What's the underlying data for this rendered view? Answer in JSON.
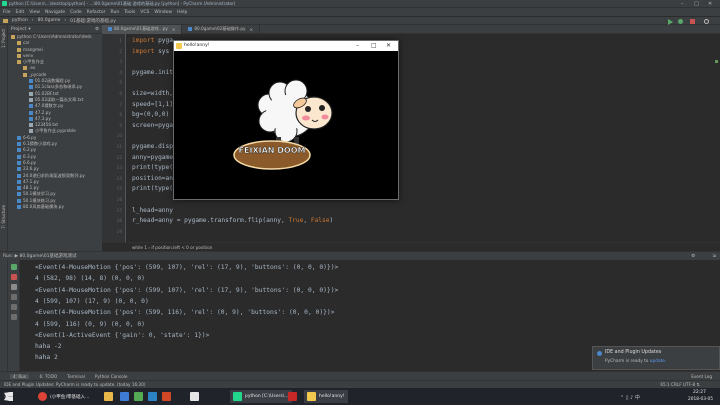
{
  "window": {
    "title": "python [C:\\Users\\...\\desktop\\python] - ...\\80.0game\\01基础:游戏的基础.py [python] - PyCharm (Administrator)"
  },
  "menu": [
    "File",
    "Edit",
    "View",
    "Navigate",
    "Code",
    "Refactor",
    "Run",
    "Tools",
    "VCS",
    "Window",
    "Help"
  ],
  "nav": {
    "crumbs": [
      "python",
      "80.0game",
      "01基础:游戏的基础.py"
    ]
  },
  "project": {
    "header": "Project",
    "items": [
      {
        "label": "python  C:\\Users\\Administrator\\desk",
        "kind": "folder",
        "indent": 0
      },
      {
        "label": "car",
        "kind": "folder",
        "indent": 1
      },
      {
        "label": "mangmei",
        "kind": "folder",
        "indent": 1
      },
      {
        "label": "venv",
        "kind": "folder",
        "indent": 1
      },
      {
        "label": "小甲鱼作业",
        "kind": "folder",
        "indent": 1
      },
      {
        "label": ".ex",
        "kind": "folder",
        "indent": 2
      },
      {
        "label": "_pycode",
        "kind": "folder",
        "indent": 2
      },
      {
        "label": "01.02函数编程.py",
        "kind": "py",
        "indent": 3
      },
      {
        "label": "01.1class多态和继承.py",
        "kind": "py",
        "indent": 3
      },
      {
        "label": "01.02BF.txt",
        "kind": "txt",
        "indent": 3
      },
      {
        "label": "05.02读取一篇长文章.txt",
        "kind": "txt",
        "indent": 3
      },
      {
        "label": "47.0猜数字.py",
        "kind": "py",
        "indent": 3
      },
      {
        "label": "47.2.py",
        "kind": "py",
        "indent": 3
      },
      {
        "label": "47.3.py",
        "kind": "py",
        "indent": 3
      },
      {
        "label": "123456.txt",
        "kind": "txt",
        "indent": 3
      },
      {
        "label": "小甲鱼作业.pyproble",
        "kind": "txt",
        "indent": 3
      },
      {
        "label": "6-6.py",
        "kind": "py",
        "indent": 1
      },
      {
        "label": "6.1猜数小游戏.py",
        "kind": "py",
        "indent": 1
      },
      {
        "label": "6.2.py",
        "kind": "py",
        "indent": 1
      },
      {
        "label": "6.3.py",
        "kind": "py",
        "indent": 1
      },
      {
        "label": "6.6.py",
        "kind": "py",
        "indent": 1
      },
      {
        "label": "23.6.py",
        "kind": "py",
        "indent": 1
      },
      {
        "label": "24.0递归求阶乘斐波那契数列.py",
        "kind": "py",
        "indent": 1
      },
      {
        "label": "47.1.py",
        "kind": "py",
        "indent": 1
      },
      {
        "label": "48.1.py",
        "kind": "py",
        "indent": 1
      },
      {
        "label": "50.1模块学习.py",
        "kind": "py",
        "indent": 1
      },
      {
        "label": "50.1模块练习.py",
        "kind": "py",
        "indent": 1
      },
      {
        "label": "80.0风扇基础模块.py",
        "kind": "py",
        "indent": 1
      }
    ]
  },
  "editor": {
    "tabs": [
      "80.0game\\01基础游戏...py",
      "80.0game\\02基础操作.py"
    ],
    "lines": [
      {
        "n": "1",
        "text": "import pyga"
      },
      {
        "n": "2",
        "text": "import sys"
      },
      {
        "n": "3",
        "text": ""
      },
      {
        "n": "4",
        "text": "pygame.init"
      },
      {
        "n": "5",
        "text": ""
      },
      {
        "n": "6",
        "text": "size=width,"
      },
      {
        "n": "7",
        "text": "speed=[1,1]"
      },
      {
        "n": "8",
        "text": "bg=(0,0,0)"
      },
      {
        "n": "9",
        "text": "screen=pyga"
      },
      {
        "n": "10",
        "text": ""
      },
      {
        "n": "11",
        "text": "pygame.disp"
      },
      {
        "n": "12",
        "text": "anny=pygame"
      },
      {
        "n": "13",
        "text": "print(type("
      },
      {
        "n": "14",
        "text": "position=an"
      },
      {
        "n": "15",
        "text": "print(type("
      },
      {
        "n": "16",
        "text": ""
      },
      {
        "n": "17",
        "text": "l_head=anny"
      },
      {
        "n": "18",
        "text": "r_head=anny = pygame.transform.flip(anny, True, False)"
      },
      {
        "n": "19",
        "text": ""
      }
    ],
    "breadcrumb": "while 1  ›  if position.left < 0 or position"
  },
  "run": {
    "header": "Run: ▶ 80.0game\\01基础游戏测试",
    "lines": [
      "<Event(4-MouseMotion {'pos': (599, 107), 'rel': (17, 9), 'buttons': (0, 0, 0)})>",
      "4 (582, 98) (14, 8) (0, 0, 0)",
      "<Event(4-MouseMotion {'pos': (599, 107), 'rel': (17, 9), 'buttons': (0, 0, 0)})>",
      "4 (599, 107) (17, 9) (0, 0, 0)",
      "<Event(4-MouseMotion {'pos': (599, 116), 'rel': (0, 9), 'buttons': (0, 0, 0)})>",
      "4 (599, 116) (0, 9) (0, 0, 0)",
      "<Event(1-ActiveEvent {'gain': 0, 'state': 1})>",
      "haha -2",
      "haha 2"
    ]
  },
  "tooltabs": [
    "4: Run",
    "6: TODO",
    "Terminal",
    "Python Console"
  ],
  "eventlog": "Event Log",
  "status": {
    "left": "IDE and Plugin Updates: PyCharm is ready to update. (today 16:20)",
    "right": "65:1  CRLF  UTF-8  ⇅"
  },
  "notification": {
    "title": "IDE and Plugin Updates",
    "body_prefix": "PyCharm is ready to ",
    "link": "update."
  },
  "pygame": {
    "title": "hello!anny!",
    "logo_text": "FEIXIAN DOOM"
  },
  "taskbar": {
    "items": [
      "(小甲鱼)零基础入...",
      "",
      "python [C:\\Users\\...",
      "",
      "hello!anny!"
    ],
    "clock_time": "22:27",
    "clock_date": "2018-03-05"
  },
  "colors": {
    "accent": "#4a88c7",
    "bg": "#2b2b2b",
    "panel": "#3c3f41"
  }
}
